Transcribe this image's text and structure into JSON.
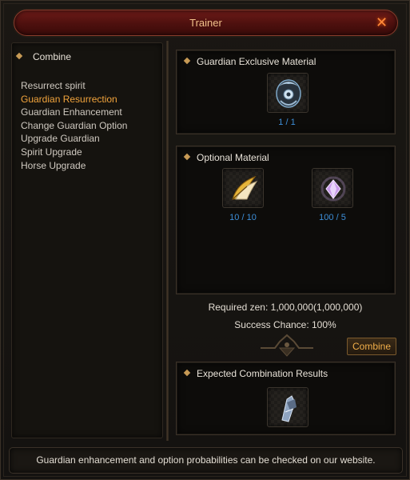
{
  "window": {
    "title": "Trainer",
    "close_icon": "close-icon (orange X)"
  },
  "sidebar": {
    "header": "Combine",
    "items": [
      {
        "label": "Resurrect spirit",
        "active": false
      },
      {
        "label": "Guardian Resurrection",
        "active": true
      },
      {
        "label": "Guardian Enhancement",
        "active": false
      },
      {
        "label": "Change Guardian Option",
        "active": false
      },
      {
        "label": "Upgrade Guardian",
        "active": false
      },
      {
        "label": "Spirit Upgrade",
        "active": false
      },
      {
        "label": "Horse Upgrade",
        "active": false
      }
    ]
  },
  "exclusive_material": {
    "title": "Guardian Exclusive Material",
    "item_icon": "guardian-emblem-icon",
    "count": "1 / 1"
  },
  "optional_material": {
    "title": "Optional Material",
    "items": [
      {
        "icon": "golden-feather-icon",
        "count": "10 / 10"
      },
      {
        "icon": "purple-gem-icon",
        "count": "100 / 5"
      }
    ]
  },
  "requirements": {
    "required_zen": "Required zen: 1,000,000(1,000,000)",
    "success_chance": "Success Chance: 100%"
  },
  "combine_button": "Combine",
  "results": {
    "title": "Expected Combination Results",
    "item_icon": "guardian-wing-icon"
  },
  "footer": {
    "text": "Guardian enhancement and option probabilities can be checked on our website."
  },
  "colors": {
    "accent_orange": "#f2a43c",
    "count_blue": "#3d8fd9",
    "title_red": "#5a1412"
  }
}
